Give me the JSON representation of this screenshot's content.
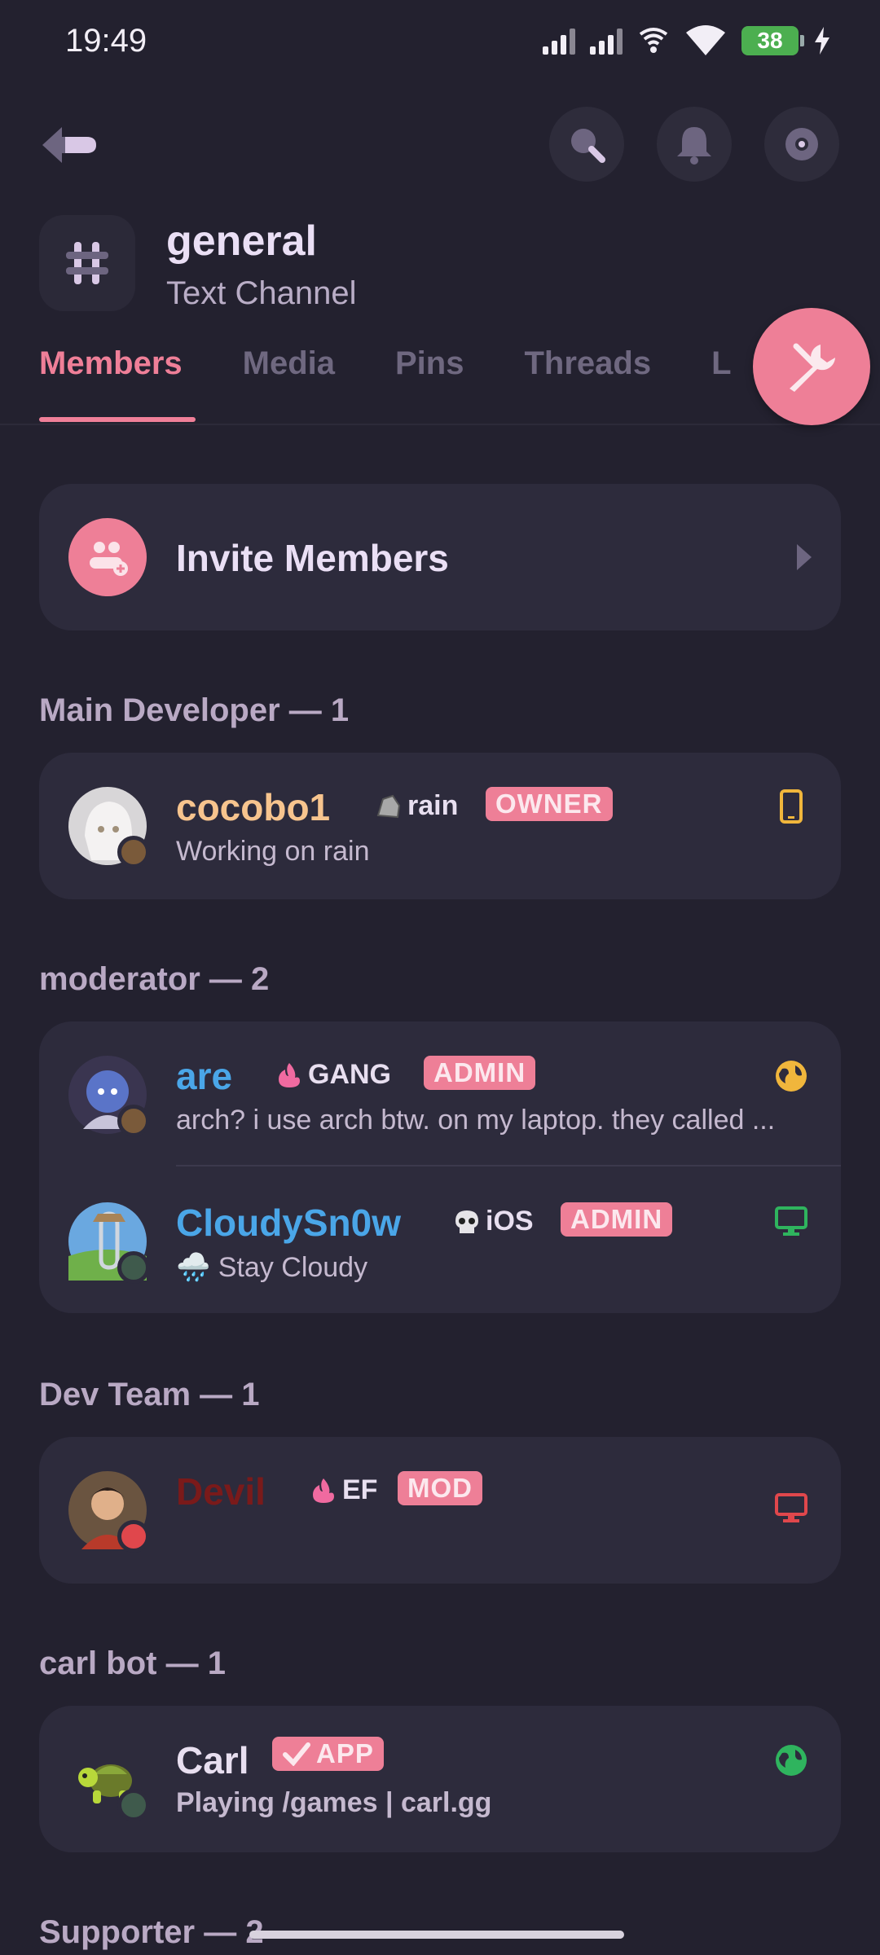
{
  "status_bar": {
    "time": "19:49",
    "battery": "38"
  },
  "channel": {
    "name": "general",
    "type": "Text Channel"
  },
  "tabs": [
    "Members",
    "Media",
    "Pins",
    "Threads",
    "L"
  ],
  "invite": {
    "label": "Invite Members"
  },
  "sections": [
    {
      "title": "Main Developer — 1"
    },
    {
      "title": "moderator — 2"
    },
    {
      "title": "Dev Team — 1"
    },
    {
      "title": "carl bot — 1"
    },
    {
      "title": "Supporter — 2"
    }
  ],
  "members": [
    {
      "name": "cocobo1",
      "name_color": "#f7c48e",
      "guild": "rain",
      "badge": "OWNER",
      "status_text": "Working on rain",
      "device_color": "#f0b63c",
      "status": "idle"
    },
    {
      "name": "are",
      "name_color": "#4aa6e8",
      "guild": "GANG",
      "badge": "ADMIN",
      "status_text": "arch? i use arch btw. on my laptop. they called ...",
      "device_color": "#f0b63c",
      "status": "idle"
    },
    {
      "name": "CloudySn0w",
      "name_color": "#4aa6e8",
      "guild": "iOS",
      "badge": "ADMIN",
      "status_text": "🌧️ Stay Cloudy",
      "device_color": "#2fb45e",
      "status": "offline"
    },
    {
      "name": "Devil",
      "name_color": "#7a1a1a",
      "guild": "EF",
      "badge": "MOD",
      "status_text": "",
      "device_color": "#e0474c",
      "status": "dnd"
    },
    {
      "name": "Carl",
      "name_color": "#e8dff0",
      "guild": "",
      "badge": "APP",
      "status_text": "Playing /games | carl.gg",
      "device_color": "#2fb45e",
      "status": "offline"
    }
  ]
}
